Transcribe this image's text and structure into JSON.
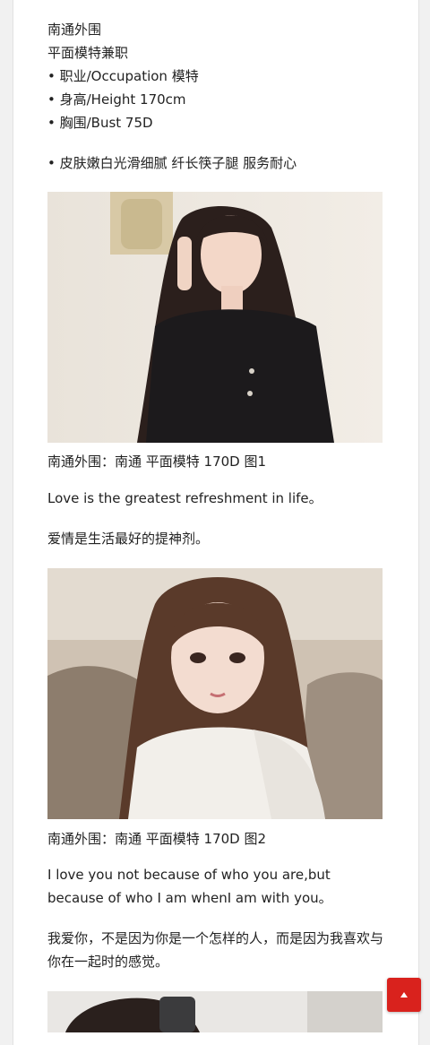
{
  "article": {
    "heading_1": "南通外围",
    "heading_2": "平面模特兼职",
    "bullets": [
      "• 职业/Occupation 模特",
      "• 身高/Height 170cm",
      "• 胸围/Bust 75D"
    ],
    "bullet_skin": "• 皮肤嫩白光滑细腻 纤长筷子腿 服务耐心",
    "caption_1": "南通外围：南通 平面模特 170D 图1",
    "quote_en_1": "Love is the greatest refreshment in life。",
    "quote_zh_1": "爱情是生活最好的提神剂。",
    "caption_2": "南通外围：南通 平面模特 170D 图2",
    "quote_en_2": "I love you not because of who you are,but because of who I am whenI am with you。",
    "quote_zh_2": "我爱你，不是因为你是一个怎样的人，而是因为我喜欢与你在一起时的感觉。"
  },
  "colors": {
    "accent": "#d9221d",
    "page_background": "#f1f1f1",
    "text": "#222222"
  },
  "icons": {
    "back_to_top": "chevron-up-icon"
  }
}
